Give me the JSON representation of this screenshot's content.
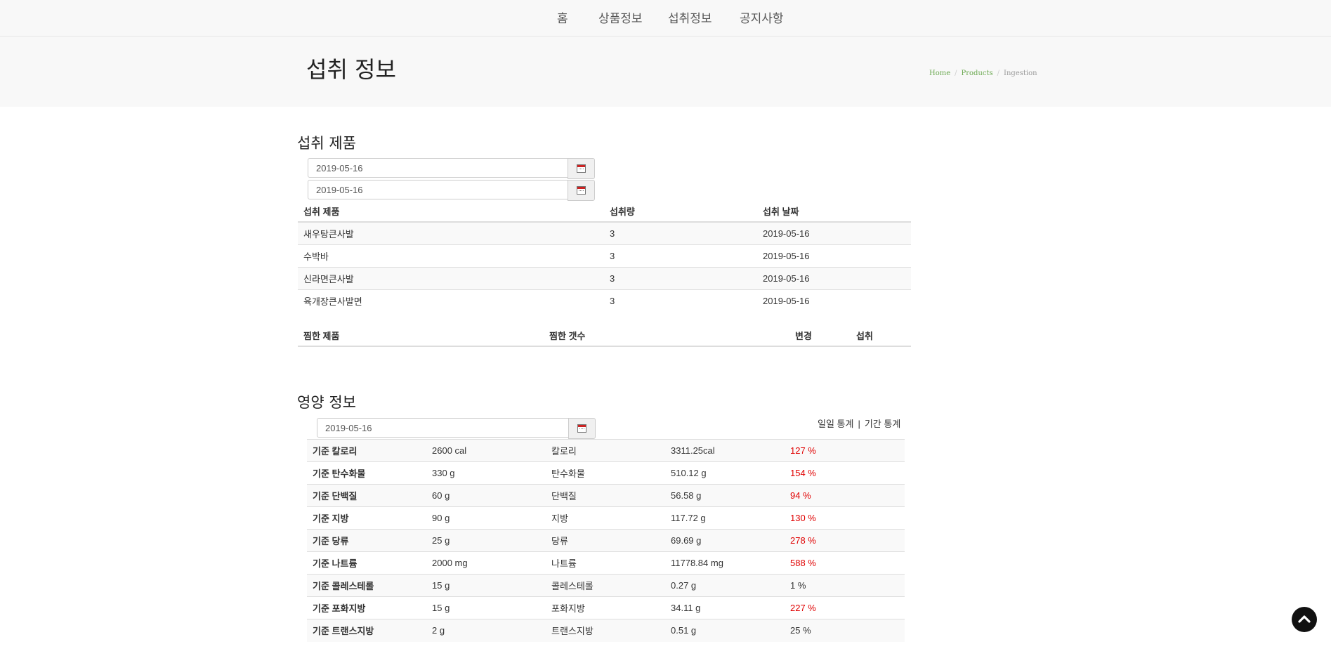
{
  "nav": {
    "items": [
      {
        "label": "홈"
      },
      {
        "label": "상품정보"
      },
      {
        "label": "섭취정보"
      },
      {
        "label": "공지사항"
      }
    ]
  },
  "header": {
    "title": "섭취 정보",
    "breadcrumb": [
      "Home",
      "Products",
      "Ingestion"
    ]
  },
  "intake": {
    "section_title": "섭취 제품",
    "start_date": "2019-05-16",
    "end_date": "2019-05-16",
    "columns": [
      "섭취 제품",
      "섭취량",
      "섭취 날짜"
    ],
    "rows": [
      [
        "새우탕큰사발",
        "3",
        "2019-05-16"
      ],
      [
        "수박바",
        "3",
        "2019-05-16"
      ],
      [
        "신라면큰사발",
        "3",
        "2019-05-16"
      ],
      [
        "육개장큰사발면",
        "3",
        "2019-05-16"
      ]
    ]
  },
  "wishlist": {
    "columns": [
      "찜한 제품",
      "찜한 갯수",
      "변경",
      "섭취"
    ]
  },
  "nutrition": {
    "section_title": "영양 정보",
    "date": "2019-05-16",
    "daily_stats_label": "일일 통계",
    "separator": "|",
    "period_stats_label": "기간 통계",
    "alert_color": "#e00000",
    "rows": [
      {
        "std_label": "기준 칼로리",
        "std_value": "2600 cal",
        "name": "칼로리",
        "value": "3311.25cal",
        "percent": "127 %",
        "over": true
      },
      {
        "std_label": "기준 탄수화물",
        "std_value": "330 g",
        "name": "탄수화물",
        "value": "510.12 g",
        "percent": "154 %",
        "over": true
      },
      {
        "std_label": "기준 단백질",
        "std_value": "60 g",
        "name": "단백질",
        "value": "56.58 g",
        "percent": "94 %",
        "over": true
      },
      {
        "std_label": "기준 지방",
        "std_value": "90 g",
        "name": "지방",
        "value": "117.72 g",
        "percent": "130 %",
        "over": true
      },
      {
        "std_label": "기준 당류",
        "std_value": "25 g",
        "name": "당류",
        "value": "69.69 g",
        "percent": "278 %",
        "over": true
      },
      {
        "std_label": "기준 나트륨",
        "std_value": "2000 mg",
        "name": "나트륨",
        "value": "11778.84 mg",
        "percent": "588 %",
        "over": true
      },
      {
        "std_label": "기준 콜레스테롤",
        "std_value": "15 g",
        "name": "콜레스테롤",
        "value": "0.27 g",
        "percent": "1 %",
        "over": false
      },
      {
        "std_label": "기준 포화지방",
        "std_value": "15 g",
        "name": "포화지방",
        "value": "34.11 g",
        "percent": "227 %",
        "over": true
      },
      {
        "std_label": "기준 트랜스지방",
        "std_value": "2 g",
        "name": "트랜스지방",
        "value": "0.51 g",
        "percent": "25 %",
        "over": false
      }
    ]
  },
  "icons": {
    "calendar": "calendar-icon",
    "scroll_top": "chevron-up-icon"
  }
}
